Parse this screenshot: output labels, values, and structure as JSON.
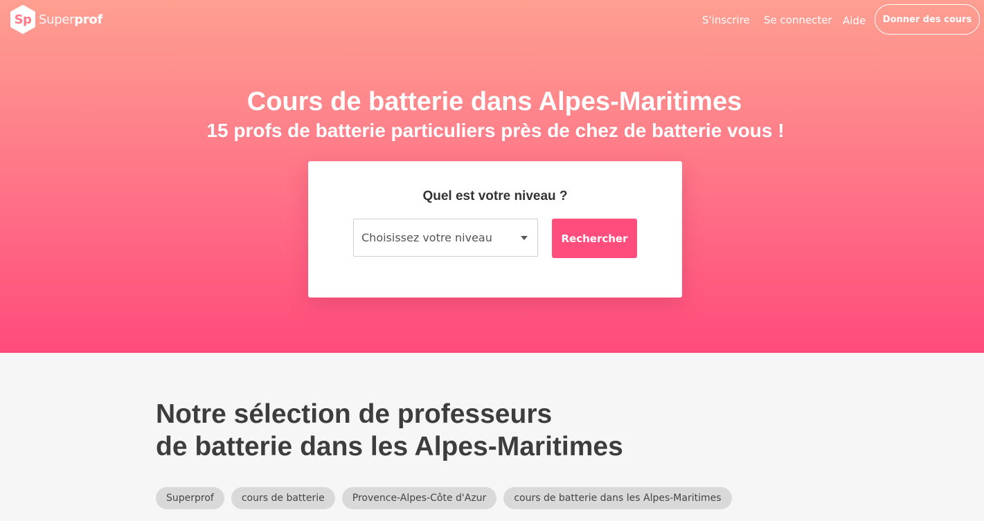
{
  "brand": {
    "logo_mark": "Sp",
    "name_light": "Super",
    "name_bold": "prof"
  },
  "nav": {
    "signup": "S'inscrire",
    "login": "Se connecter",
    "help": "Aide",
    "teach": "Donner des cours"
  },
  "hero": {
    "title": "Cours de batterie dans Alpes-Maritimes",
    "subtitle": "15 profs de batterie particuliers près de chez de batterie vous !"
  },
  "search": {
    "question": "Quel est votre niveau ?",
    "level_placeholder": "Choisissez votre niveau",
    "button": "Rechercher"
  },
  "selection": {
    "title_line1": "Notre sélection de professeurs",
    "title_line2": "de batterie dans les Alpes-Maritimes"
  },
  "breadcrumb": [
    "Superprof",
    "cours de batterie",
    "Provence-Alpes-Côte d'Azur",
    "cours de batterie dans les Alpes-Maritimes"
  ],
  "colors": {
    "accent": "#ff4d7d",
    "hero_top": "#fe9f91",
    "hero_bottom": "#ff4b7a"
  }
}
